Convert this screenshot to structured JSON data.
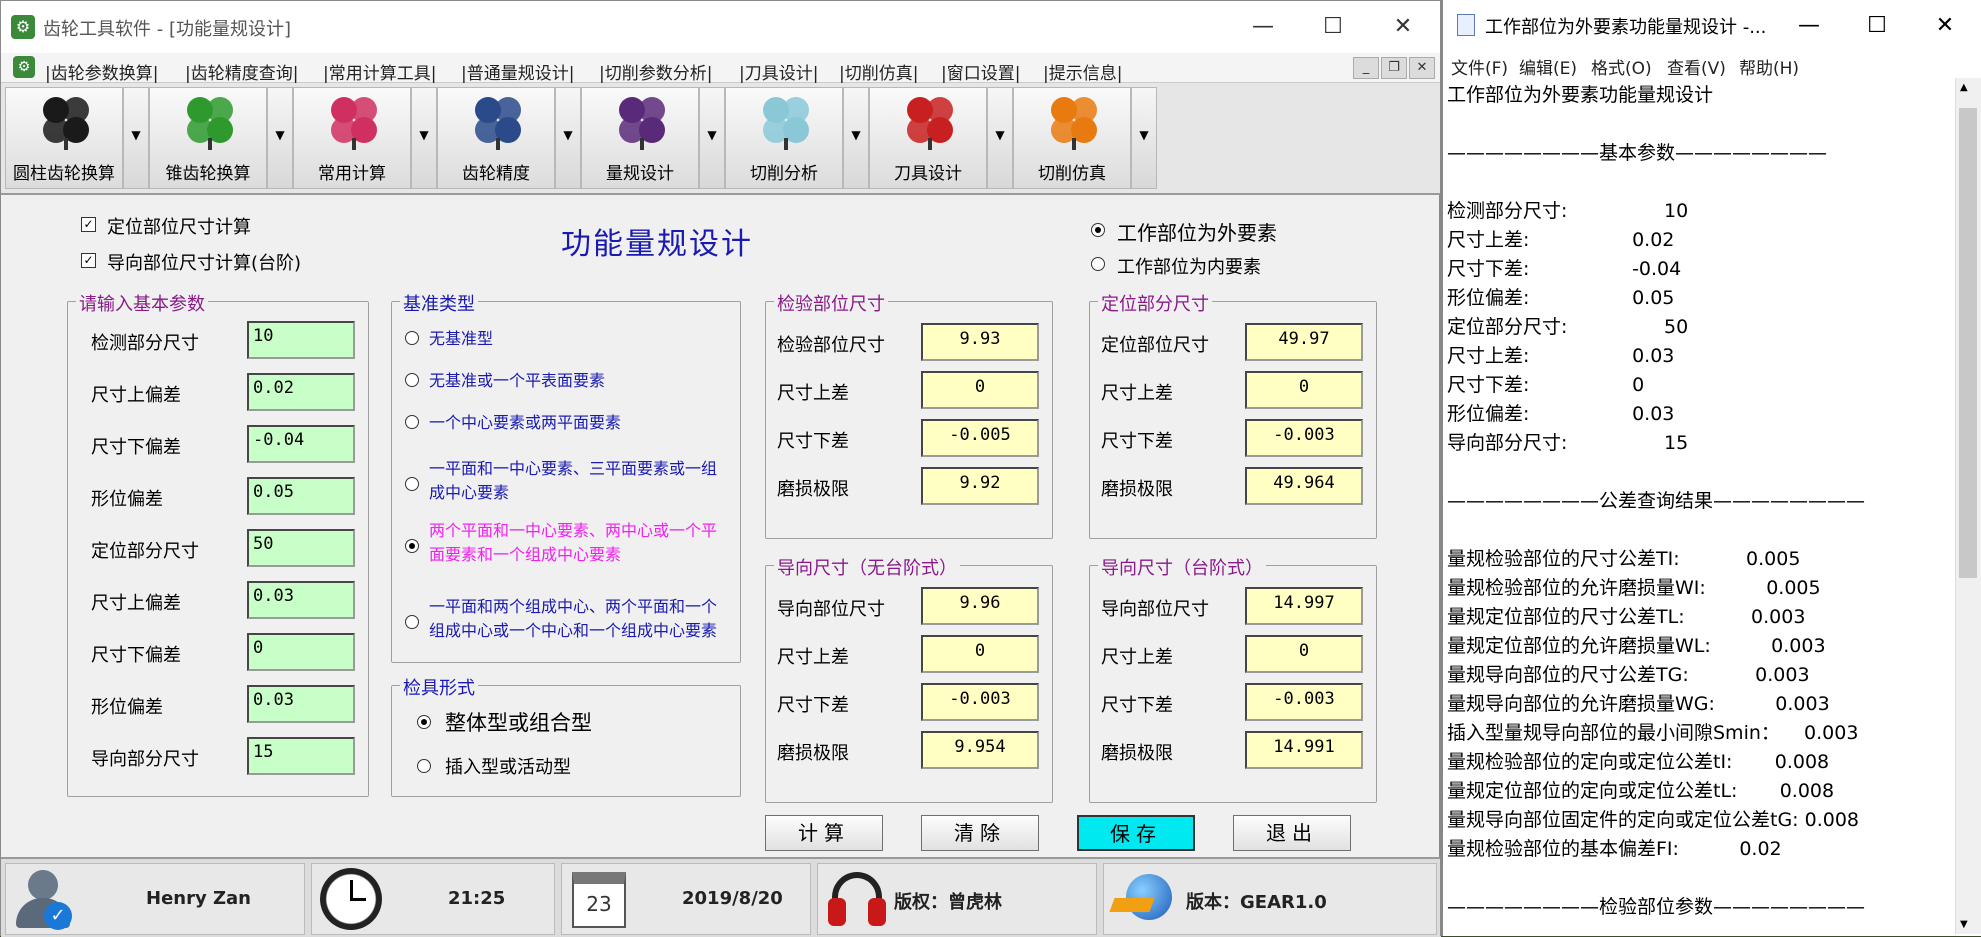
{
  "app": {
    "title": "齿轮工具软件 - [功能量规设计]",
    "minimize": "—",
    "maximize": "☐",
    "close": "✕"
  },
  "menu": [
    "|齿轮参数换算|",
    "|齿轮精度查询|",
    "|常用计算工具|",
    "|普通量规设计|",
    "|切削参数分析|",
    "|刀具设计|",
    "|切削仿真|",
    "|窗口设置|",
    "|提示信息|"
  ],
  "mdi_controls": {
    "min": "_",
    "restore": "❐",
    "close": "✕"
  },
  "toolbar": [
    {
      "label": "圆柱齿轮换算",
      "icon": "clover-black-icon",
      "color": "#1a1a1a"
    },
    {
      "label": "锥齿轮换算",
      "icon": "clover-green-icon",
      "color": "#2e9a2e"
    },
    {
      "label": "常用计算",
      "icon": "clover-multicolor-icon",
      "color": "#d03060"
    },
    {
      "label": "齿轮精度",
      "icon": "clover-blue-icon",
      "color": "#2a4a8a"
    },
    {
      "label": "量规设计",
      "icon": "clover-purple-icon",
      "color": "#5a2a7a"
    },
    {
      "label": "切削分析",
      "icon": "clover-lightblue-icon",
      "color": "#8ac8d8"
    },
    {
      "label": "刀具设计",
      "icon": "clover-red-black-icon",
      "color": "#c82020"
    },
    {
      "label": "切削仿真",
      "icon": "clover-orange-icon",
      "color": "#e87a10"
    }
  ],
  "form": {
    "title": "功能量规设计",
    "chk_locate": "定位部位尺寸计算",
    "chk_guide": "导向部位尺寸计算(台阶)",
    "radio_outer": "工作部位为外要素",
    "radio_inner": "工作部位为内要素",
    "input_group": {
      "title": "请输入基本参数",
      "rows": [
        {
          "label": "检测部分尺寸",
          "value": "10"
        },
        {
          "label": "尺寸上偏差",
          "value": "0.02"
        },
        {
          "label": "尺寸下偏差",
          "value": "-0.04"
        },
        {
          "label": "形位偏差",
          "value": "0.05"
        },
        {
          "label": "定位部分尺寸",
          "value": "50"
        },
        {
          "label": "尺寸上偏差",
          "value": "0.03"
        },
        {
          "label": "尺寸下偏差",
          "value": "0"
        },
        {
          "label": "形位偏差",
          "value": "0.03"
        },
        {
          "label": "导向部分尺寸",
          "value": "15"
        }
      ]
    },
    "datum_group": {
      "title": "基准类型",
      "options": [
        {
          "text": "无基准型"
        },
        {
          "text": "无基准或一个平表面要素"
        },
        {
          "text": "一个中心要素或两平面要素"
        },
        {
          "text": "一平面和一中心要素、三平面要素或一组成中心要素"
        },
        {
          "text": "两个平面和一中心要素、两中心或一个平面要素和一个组成中心要素",
          "selected": true
        },
        {
          "text": "一平面和两个组成中心、两个平面和一个组成中心或一个中心和一个组成中心要素"
        }
      ]
    },
    "fixture_group": {
      "title": "检具形式",
      "options": [
        {
          "text": "整体型或组合型",
          "selected": true
        },
        {
          "text": "插入型或活动型"
        }
      ]
    },
    "inspect_group": {
      "title": "检验部位尺寸",
      "rows": [
        {
          "label": "检验部位尺寸",
          "value": "9.93"
        },
        {
          "label": "尺寸上差",
          "value": "0"
        },
        {
          "label": "尺寸下差",
          "value": "-0.005"
        },
        {
          "label": "磨损极限",
          "value": "9.92"
        }
      ]
    },
    "locate_group": {
      "title": "定位部分尺寸",
      "rows": [
        {
          "label": "定位部位尺寸",
          "value": "49.97"
        },
        {
          "label": "尺寸上差",
          "value": "0"
        },
        {
          "label": "尺寸下差",
          "value": "-0.003"
        },
        {
          "label": "磨损极限",
          "value": "49.964"
        }
      ]
    },
    "guide_flat_group": {
      "title": "导向尺寸（无台阶式）",
      "rows": [
        {
          "label": "导向部位尺寸",
          "value": "9.96"
        },
        {
          "label": "尺寸上差",
          "value": "0"
        },
        {
          "label": "尺寸下差",
          "value": "-0.003"
        },
        {
          "label": "磨损极限",
          "value": "9.954"
        }
      ]
    },
    "guide_step_group": {
      "title": "导向尺寸（台阶式）",
      "rows": [
        {
          "label": "导向部位尺寸",
          "value": "14.997"
        },
        {
          "label": "尺寸上差",
          "value": "0"
        },
        {
          "label": "尺寸下差",
          "value": "-0.003"
        },
        {
          "label": "磨损极限",
          "value": "14.991"
        }
      ]
    },
    "buttons": {
      "calc": "计算",
      "clear": "清除",
      "save": "保存",
      "exit": "退出"
    },
    "save_color": "#00ffff"
  },
  "status": {
    "user": "Henry Zan",
    "time": "21:25",
    "calendar_day": "23",
    "date": "2019/8/20",
    "copyright": "版权：曾虎林",
    "version": "版本：GEAR1.0"
  },
  "notepad": {
    "title": "工作部位为外要素功能量规设计 -...",
    "menu": [
      "文件(F)",
      "编辑(E)",
      "格式(O)",
      "查看(V)",
      "帮助(H)"
    ],
    "lines": [
      "工作部位为外要素功能量规设计",
      "",
      "————————基本参数————————",
      "",
      "检测部分尺寸:                10",
      "尺寸上差:                 0.02",
      "尺寸下差:                 -0.04",
      "形位偏差:                 0.05",
      "定位部分尺寸:                50",
      "尺寸上差:                 0.03",
      "尺寸下差:                 0",
      "形位偏差:                 0.03",
      "导向部分尺寸:                15",
      "",
      "————————公差查询结果————————",
      "",
      "量规检验部位的尺寸公差TI:           0.005",
      "量规检验部位的允许磨损量WI:          0.005",
      "量规定位部位的尺寸公差TL:           0.003",
      "量规定位部位的允许磨损量WL:          0.003",
      "量规导向部位的尺寸公差TG:           0.003",
      "量规导向部位的允许磨损量WG:          0.003",
      "插入型量规导向部位的最小间隙Smin：    0.003",
      "量规检验部位的定向或定位公差tI:       0.008",
      "量规定位部位的定向或定位公差tL:       0.008",
      "量规导向部位固定件的定向或定位公差tG: 0.008",
      "量规检验部位的基本偏差FI:          0.02",
      "",
      "————————检验部位参数————————"
    ]
  }
}
